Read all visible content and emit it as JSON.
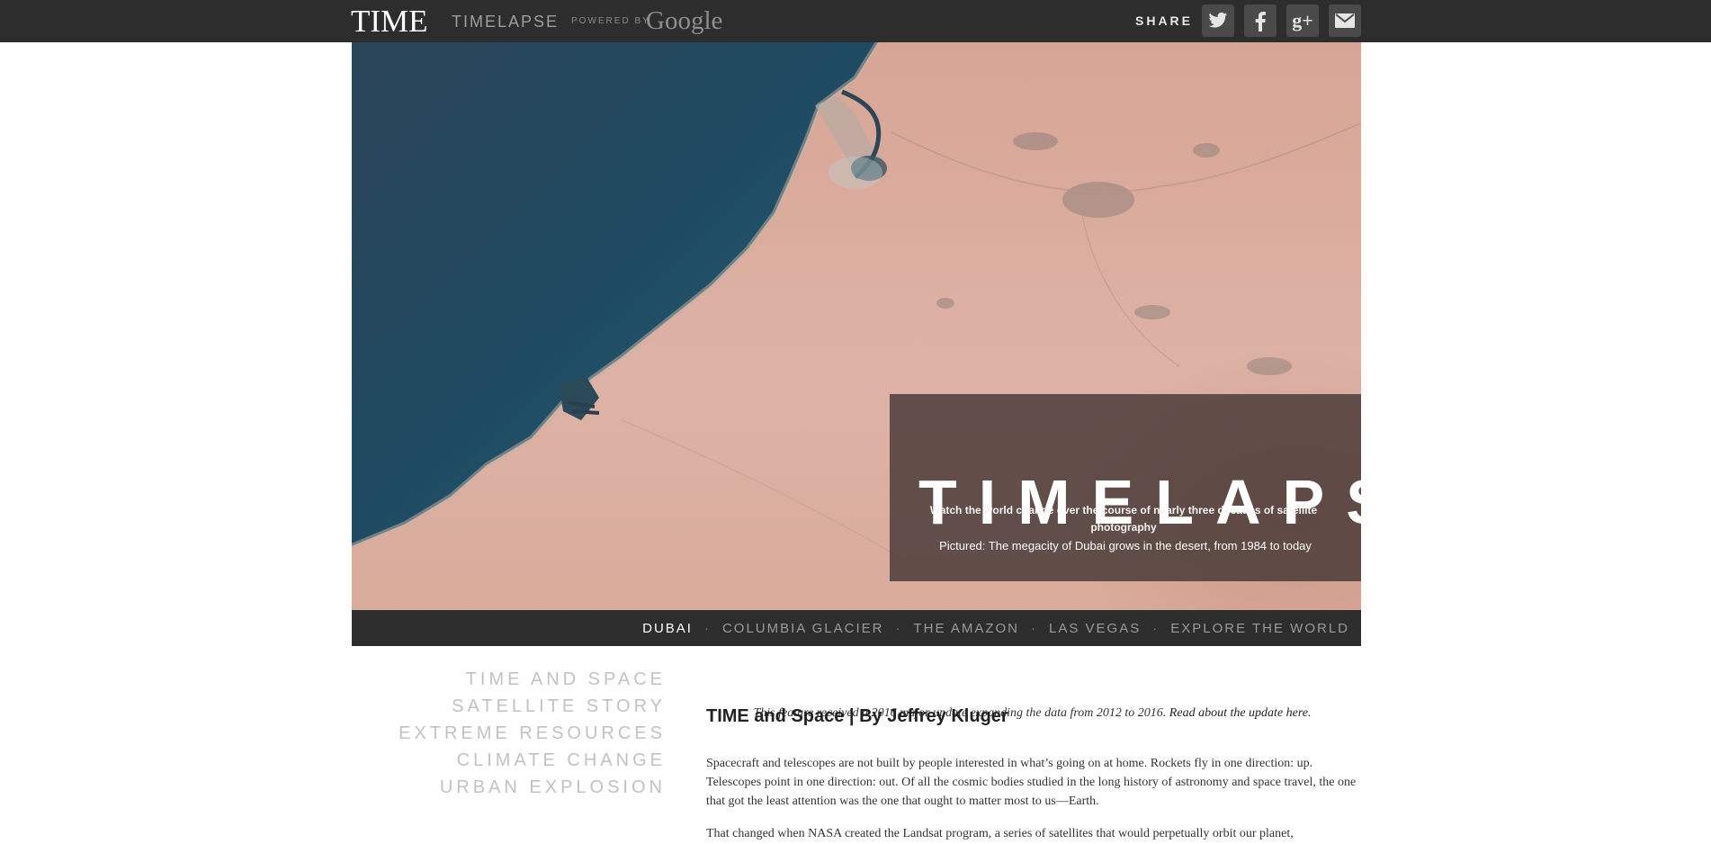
{
  "header": {
    "brand": "TIME",
    "section": "TIMELAPSE",
    "powered_by": "POWERED BY",
    "google": "Google",
    "share_label": "SHARE",
    "share_buttons": [
      {
        "icon": "twitter-icon"
      },
      {
        "icon": "facebook-icon"
      },
      {
        "icon": "google-plus-icon",
        "glyph": "g+"
      },
      {
        "icon": "email-icon"
      }
    ]
  },
  "hero": {
    "title": "TIMELAPSE",
    "subtitle": "Watch the world change over the course of nearly three decades of satellite photography",
    "caption": "Pictured: The megacity of Dubai grows in the desert, from 1984 to today",
    "colors": {
      "sea": "#1f4a63",
      "desert": "#d9ab9b",
      "overlay": "#463836"
    }
  },
  "locations": {
    "items": [
      "DUBAI",
      "COLUMBIA GLACIER",
      "THE AMAZON",
      "LAS VEGAS",
      "EXPLORE THE WORLD"
    ],
    "separator": "·",
    "active": "DUBAI"
  },
  "sidenav": {
    "items": [
      "TIME AND SPACE",
      "SATELLITE STORY",
      "EXTREME RESOURCES",
      "CLIMATE CHANGE",
      "URBAN EXPLOSION"
    ]
  },
  "article": {
    "headline": "TIME and Space | By Jeffrey Kluger",
    "update_note": "This feature received a 2016 major update expanding the data from 2012 to 2016.",
    "update_link": "Read about the update here.",
    "paragraphs": [
      "Spacecraft and telescopes are not built by people interested in what’s going on at home. Rockets fly in one direction: up. Telescopes point in one direction: out. Of all the cosmic bodies studied in the long history of astronomy and space travel, the one that got the least attention was the one that ought to matter most to us—Earth.",
      "That changed when NASA created the Landsat program, a series of satellites that would perpetually orbit our planet,"
    ]
  }
}
